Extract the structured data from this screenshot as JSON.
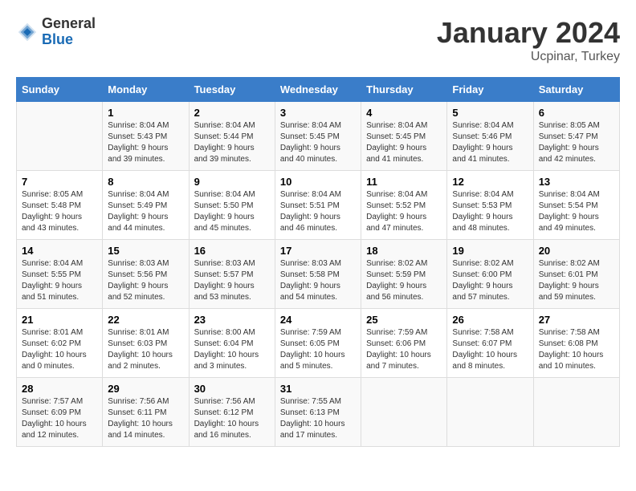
{
  "logo": {
    "general": "General",
    "blue": "Blue"
  },
  "header": {
    "month_year": "January 2024",
    "location": "Ucpinar, Turkey"
  },
  "days_of_week": [
    "Sunday",
    "Monday",
    "Tuesday",
    "Wednesday",
    "Thursday",
    "Friday",
    "Saturday"
  ],
  "weeks": [
    [
      {
        "day": "",
        "info": ""
      },
      {
        "day": "1",
        "info": "Sunrise: 8:04 AM\nSunset: 5:43 PM\nDaylight: 9 hours\nand 39 minutes."
      },
      {
        "day": "2",
        "info": "Sunrise: 8:04 AM\nSunset: 5:44 PM\nDaylight: 9 hours\nand 39 minutes."
      },
      {
        "day": "3",
        "info": "Sunrise: 8:04 AM\nSunset: 5:45 PM\nDaylight: 9 hours\nand 40 minutes."
      },
      {
        "day": "4",
        "info": "Sunrise: 8:04 AM\nSunset: 5:45 PM\nDaylight: 9 hours\nand 41 minutes."
      },
      {
        "day": "5",
        "info": "Sunrise: 8:04 AM\nSunset: 5:46 PM\nDaylight: 9 hours\nand 41 minutes."
      },
      {
        "day": "6",
        "info": "Sunrise: 8:05 AM\nSunset: 5:47 PM\nDaylight: 9 hours\nand 42 minutes."
      }
    ],
    [
      {
        "day": "7",
        "info": "Sunrise: 8:05 AM\nSunset: 5:48 PM\nDaylight: 9 hours\nand 43 minutes."
      },
      {
        "day": "8",
        "info": "Sunrise: 8:04 AM\nSunset: 5:49 PM\nDaylight: 9 hours\nand 44 minutes."
      },
      {
        "day": "9",
        "info": "Sunrise: 8:04 AM\nSunset: 5:50 PM\nDaylight: 9 hours\nand 45 minutes."
      },
      {
        "day": "10",
        "info": "Sunrise: 8:04 AM\nSunset: 5:51 PM\nDaylight: 9 hours\nand 46 minutes."
      },
      {
        "day": "11",
        "info": "Sunrise: 8:04 AM\nSunset: 5:52 PM\nDaylight: 9 hours\nand 47 minutes."
      },
      {
        "day": "12",
        "info": "Sunrise: 8:04 AM\nSunset: 5:53 PM\nDaylight: 9 hours\nand 48 minutes."
      },
      {
        "day": "13",
        "info": "Sunrise: 8:04 AM\nSunset: 5:54 PM\nDaylight: 9 hours\nand 49 minutes."
      }
    ],
    [
      {
        "day": "14",
        "info": "Sunrise: 8:04 AM\nSunset: 5:55 PM\nDaylight: 9 hours\nand 51 minutes."
      },
      {
        "day": "15",
        "info": "Sunrise: 8:03 AM\nSunset: 5:56 PM\nDaylight: 9 hours\nand 52 minutes."
      },
      {
        "day": "16",
        "info": "Sunrise: 8:03 AM\nSunset: 5:57 PM\nDaylight: 9 hours\nand 53 minutes."
      },
      {
        "day": "17",
        "info": "Sunrise: 8:03 AM\nSunset: 5:58 PM\nDaylight: 9 hours\nand 54 minutes."
      },
      {
        "day": "18",
        "info": "Sunrise: 8:02 AM\nSunset: 5:59 PM\nDaylight: 9 hours\nand 56 minutes."
      },
      {
        "day": "19",
        "info": "Sunrise: 8:02 AM\nSunset: 6:00 PM\nDaylight: 9 hours\nand 57 minutes."
      },
      {
        "day": "20",
        "info": "Sunrise: 8:02 AM\nSunset: 6:01 PM\nDaylight: 9 hours\nand 59 minutes."
      }
    ],
    [
      {
        "day": "21",
        "info": "Sunrise: 8:01 AM\nSunset: 6:02 PM\nDaylight: 10 hours\nand 0 minutes."
      },
      {
        "day": "22",
        "info": "Sunrise: 8:01 AM\nSunset: 6:03 PM\nDaylight: 10 hours\nand 2 minutes."
      },
      {
        "day": "23",
        "info": "Sunrise: 8:00 AM\nSunset: 6:04 PM\nDaylight: 10 hours\nand 3 minutes."
      },
      {
        "day": "24",
        "info": "Sunrise: 7:59 AM\nSunset: 6:05 PM\nDaylight: 10 hours\nand 5 minutes."
      },
      {
        "day": "25",
        "info": "Sunrise: 7:59 AM\nSunset: 6:06 PM\nDaylight: 10 hours\nand 7 minutes."
      },
      {
        "day": "26",
        "info": "Sunrise: 7:58 AM\nSunset: 6:07 PM\nDaylight: 10 hours\nand 8 minutes."
      },
      {
        "day": "27",
        "info": "Sunrise: 7:58 AM\nSunset: 6:08 PM\nDaylight: 10 hours\nand 10 minutes."
      }
    ],
    [
      {
        "day": "28",
        "info": "Sunrise: 7:57 AM\nSunset: 6:09 PM\nDaylight: 10 hours\nand 12 minutes."
      },
      {
        "day": "29",
        "info": "Sunrise: 7:56 AM\nSunset: 6:11 PM\nDaylight: 10 hours\nand 14 minutes."
      },
      {
        "day": "30",
        "info": "Sunrise: 7:56 AM\nSunset: 6:12 PM\nDaylight: 10 hours\nand 16 minutes."
      },
      {
        "day": "31",
        "info": "Sunrise: 7:55 AM\nSunset: 6:13 PM\nDaylight: 10 hours\nand 17 minutes."
      },
      {
        "day": "",
        "info": ""
      },
      {
        "day": "",
        "info": ""
      },
      {
        "day": "",
        "info": ""
      }
    ]
  ]
}
